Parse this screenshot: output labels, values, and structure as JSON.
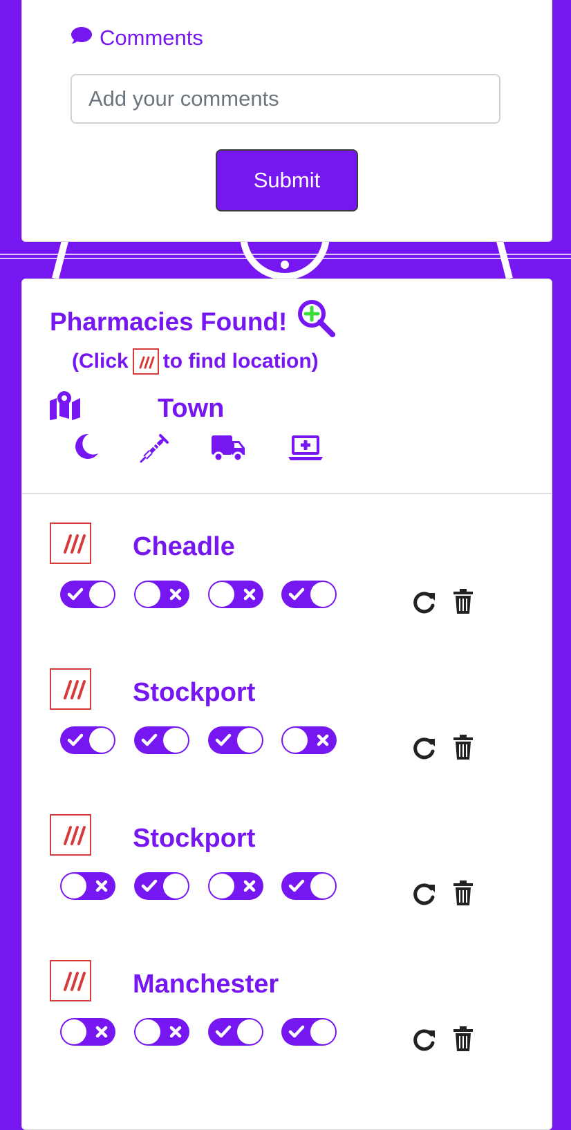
{
  "colors": {
    "accent": "#7617f2",
    "map_icon_red": "#d63b3b",
    "magnifier_plus": "#3cdc3c"
  },
  "comments": {
    "label": "Comments",
    "icon": "comment-icon",
    "placeholder": "Add your comments",
    "value": "",
    "submit_label": "Submit"
  },
  "results": {
    "title": "Pharmacies Found!",
    "title_icon": "search-plus-icon",
    "hint_prefix": "(Click",
    "hint_suffix": "to find location)",
    "hint_icon": "map-location-icon",
    "town_header": "Town",
    "town_icon": "map-icon",
    "service_icons": [
      "moon-icon",
      "syringe-icon",
      "truck-icon",
      "laptop-medical-icon"
    ],
    "rows": [
      {
        "name": "Cheadle",
        "toggles": [
          true,
          false,
          false,
          true
        ]
      },
      {
        "name": "Stockport",
        "toggles": [
          true,
          true,
          true,
          false
        ]
      },
      {
        "name": "Stockport",
        "toggles": [
          false,
          true,
          false,
          true
        ]
      },
      {
        "name": "Manchester",
        "toggles": [
          false,
          false,
          true,
          true
        ]
      }
    ],
    "row_actions": [
      "refresh-icon",
      "trash-icon"
    ]
  }
}
